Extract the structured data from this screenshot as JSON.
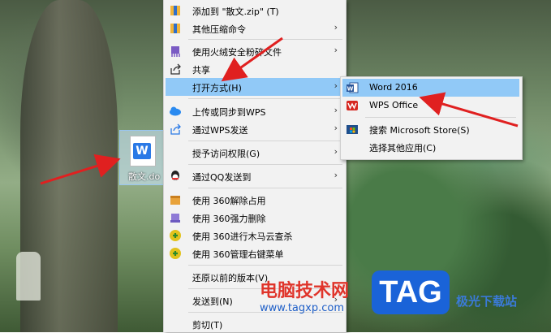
{
  "file": {
    "name": "散文.do"
  },
  "menu": {
    "items": [
      {
        "label": "添加到 \"散文.zip\" (T)",
        "icon": "archive-icon",
        "arrow": ""
      },
      {
        "label": "其他压缩命令",
        "icon": "archive-icon",
        "arrow": "›"
      },
      {
        "label": "使用火绒安全粉碎文件",
        "icon": "shred-icon",
        "arrow": "›"
      },
      {
        "label": "共享",
        "icon": "share-icon",
        "arrow": ""
      },
      {
        "label": "打开方式(H)",
        "icon": "",
        "arrow": "›"
      },
      {
        "label": "上传或同步到WPS",
        "icon": "cloud-icon",
        "arrow": "›"
      },
      {
        "label": "通过WPS发送",
        "icon": "send-icon",
        "arrow": "›"
      },
      {
        "label": "授予访问权限(G)",
        "icon": "",
        "arrow": "›"
      },
      {
        "label": "通过QQ发送到",
        "icon": "qq-icon",
        "arrow": "›"
      },
      {
        "label": "使用 360解除占用",
        "icon": "360-unlock-icon",
        "arrow": ""
      },
      {
        "label": "使用 360强力删除",
        "icon": "360-delete-icon",
        "arrow": ""
      },
      {
        "label": "使用 360进行木马云查杀",
        "icon": "360-scan-icon",
        "arrow": ""
      },
      {
        "label": "使用 360管理右键菜单",
        "icon": "360-manage-icon",
        "arrow": ""
      },
      {
        "label": "还原以前的版本(V)",
        "icon": "",
        "arrow": ""
      },
      {
        "label": "发送到(N)",
        "icon": "",
        "arrow": "›"
      },
      {
        "label": "剪切(T)",
        "icon": "",
        "arrow": ""
      }
    ]
  },
  "submenu": {
    "items": [
      {
        "label": "Word 2016",
        "icon": "word-icon"
      },
      {
        "label": "WPS Office",
        "icon": "wps-icon"
      },
      {
        "label": "搜索 Microsoft Store(S)",
        "icon": "store-icon"
      },
      {
        "label": "选择其他应用(C)",
        "icon": ""
      }
    ]
  },
  "watermark": {
    "brand": "电脑技术网",
    "url": "www.tagxp.com",
    "tag": "TAG",
    "right": "极光下载站"
  },
  "colors": {
    "highlight": "#91c9f7",
    "arrow": "#e02020",
    "wps_blue": "#2a79e6"
  }
}
